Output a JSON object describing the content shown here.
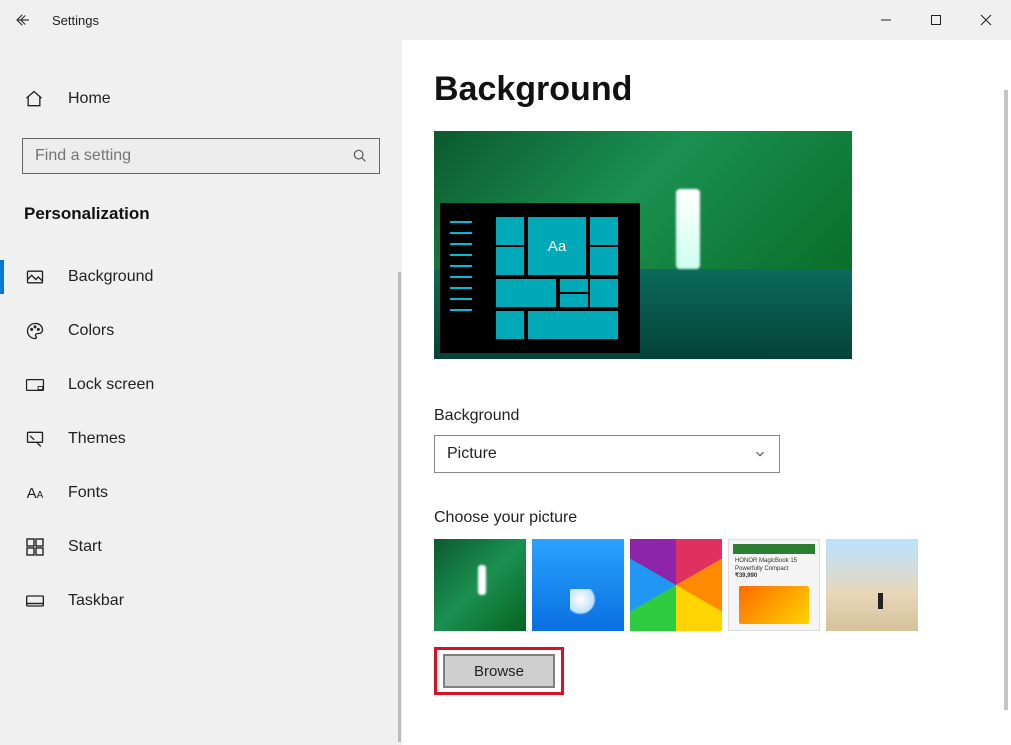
{
  "window": {
    "title": "Settings"
  },
  "sidebar": {
    "home_label": "Home",
    "search_placeholder": "Find a setting",
    "category_title": "Personalization",
    "items": [
      {
        "label": "Background",
        "icon": "picture-icon",
        "active": true
      },
      {
        "label": "Colors",
        "icon": "palette-icon"
      },
      {
        "label": "Lock screen",
        "icon": "lockscreen-icon"
      },
      {
        "label": "Themes",
        "icon": "brush-icon"
      },
      {
        "label": "Fonts",
        "icon": "fonts-icon"
      },
      {
        "label": "Start",
        "icon": "start-icon"
      },
      {
        "label": "Taskbar",
        "icon": "taskbar-icon"
      }
    ]
  },
  "content": {
    "page_title": "Background",
    "preview_sample_text": "Aa",
    "bg_label": "Background",
    "bg_selected": "Picture",
    "choose_label": "Choose your picture",
    "browse_label": "Browse"
  }
}
